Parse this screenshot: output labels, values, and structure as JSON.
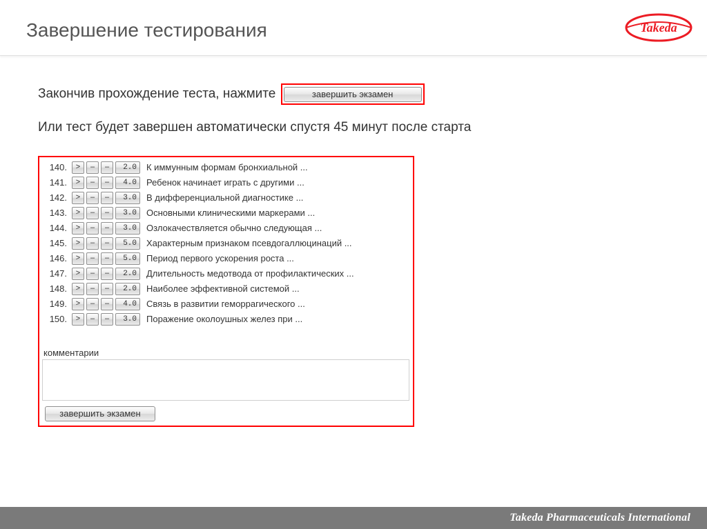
{
  "header": {
    "title": "Завершение тестирования",
    "logo_text": "Takeda"
  },
  "instructions": {
    "line1": "Закончив прохождение теста, нажмите",
    "finish_button_label": "завершить экзамен",
    "line2": "Или тест будет завершен автоматически спустя 45 минут после старта"
  },
  "panel": {
    "questions": [
      {
        "num": "140.",
        "gt": ">",
        "dash": "–",
        "dash2": "–",
        "score": "2.0",
        "text": "К иммунным формам бронхиальной ..."
      },
      {
        "num": "141.",
        "gt": ">",
        "dash": "–",
        "dash2": "–",
        "score": "4.0",
        "text": "Ребенок начинает играть с другими ..."
      },
      {
        "num": "142.",
        "gt": ">",
        "dash": "–",
        "dash2": "–",
        "score": "3.0",
        "text": "В дифференциальной диагностике ..."
      },
      {
        "num": "143.",
        "gt": ">",
        "dash": "–",
        "dash2": "–",
        "score": "3.0",
        "text": "Основными клиническими маркерами ..."
      },
      {
        "num": "144.",
        "gt": ">",
        "dash": "–",
        "dash2": "–",
        "score": "3.0",
        "text": "Озлокачествляется обычно следующая ..."
      },
      {
        "num": "145.",
        "gt": ">",
        "dash": "–",
        "dash2": "–",
        "score": "5.0",
        "text": "Характерным признаком псевдогаллюцинаций ..."
      },
      {
        "num": "146.",
        "gt": ">",
        "dash": "–",
        "dash2": "–",
        "score": "5.0",
        "text": "Период первого ускорения роста ..."
      },
      {
        "num": "147.",
        "gt": ">",
        "dash": "–",
        "dash2": "–",
        "score": "2.0",
        "text": "Длительность медотвода от профилактических ..."
      },
      {
        "num": "148.",
        "gt": ">",
        "dash": "–",
        "dash2": "–",
        "score": "2.0",
        "text": "Наиболее эффективной системой ..."
      },
      {
        "num": "149.",
        "gt": ">",
        "dash": "–",
        "dash2": "–",
        "score": "4.0",
        "text": "Связь в развитии геморрагического ..."
      },
      {
        "num": "150.",
        "gt": ">",
        "dash": "–",
        "dash2": "–",
        "score": "3.0",
        "text": "Поражение околоушных желез при ..."
      }
    ],
    "comments_label": "комментарии",
    "finish_button_label": "завершить экзамен"
  },
  "footer": {
    "text": "Takeda Pharmaceuticals International"
  },
  "colors": {
    "accent_red": "#ff0000",
    "brand_red": "#ec1c24",
    "footer_grey": "#7a7a7a"
  }
}
